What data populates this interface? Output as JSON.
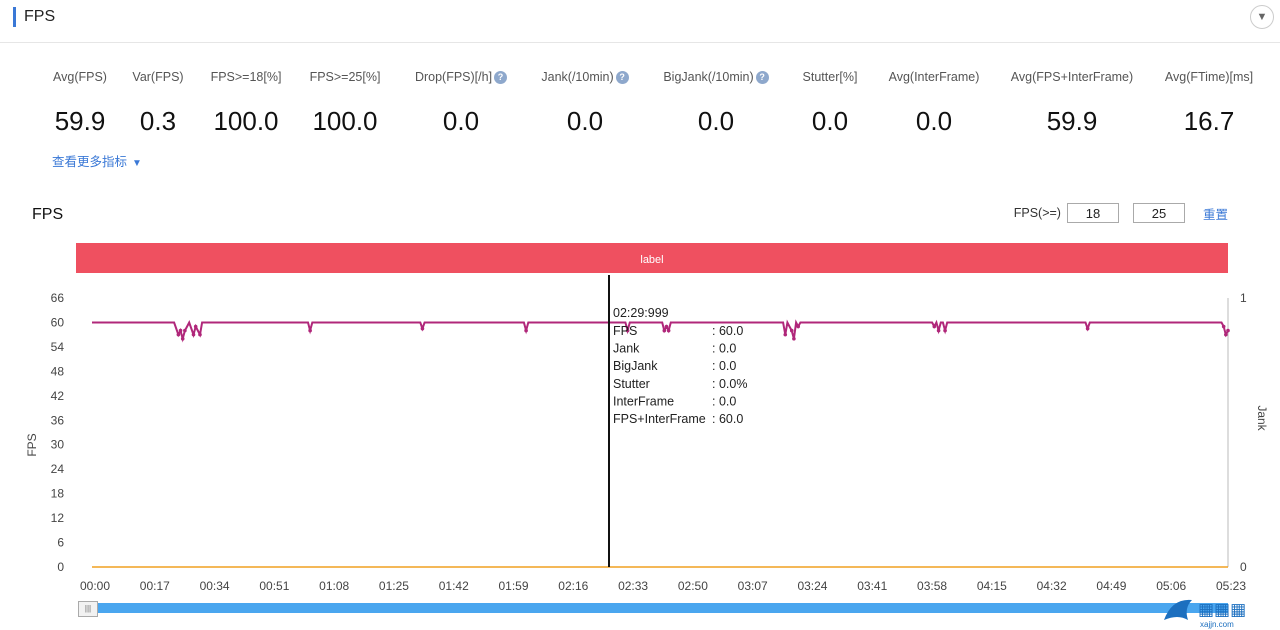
{
  "panel": {
    "title": "FPS"
  },
  "metrics": [
    {
      "label": "Avg(FPS)",
      "value": "59.9",
      "help": false
    },
    {
      "label": "Var(FPS)",
      "value": "0.3",
      "help": false
    },
    {
      "label": "FPS>=18[%]",
      "value": "100.0",
      "help": false
    },
    {
      "label": "FPS>=25[%]",
      "value": "100.0",
      "help": false
    },
    {
      "label": "Drop(FPS)[/h]",
      "value": "0.0",
      "help": true
    },
    {
      "label": "Jank(/10min)",
      "value": "0.0",
      "help": true
    },
    {
      "label": "BigJank(/10min)",
      "value": "0.0",
      "help": true
    },
    {
      "label": "Stutter[%]",
      "value": "0.0",
      "help": false
    },
    {
      "label": "Avg(InterFrame)",
      "value": "0.0",
      "help": false
    },
    {
      "label": "Avg(FPS+InterFrame)",
      "value": "59.9",
      "help": false
    },
    {
      "label": "Avg(FTime)[ms]",
      "value": "16.7",
      "help": false
    }
  ],
  "more_link": "查看更多指标",
  "chart_header": {
    "title": "FPS",
    "threshold_label": "FPS(>=)",
    "threshold_1": "18",
    "threshold_2": "25",
    "reset_label": "重置"
  },
  "label_bar": {
    "text": "label",
    "color": "#ef5060"
  },
  "tooltip": {
    "time": "02:29:999",
    "rows": [
      {
        "k": "FPS",
        "v": ": 60.0"
      },
      {
        "k": "Jank",
        "v": ": 0.0"
      },
      {
        "k": "BigJank",
        "v": ": 0.0"
      },
      {
        "k": "Stutter",
        "v": ": 0.0%"
      },
      {
        "k": "InterFrame",
        "v": ": 0.0"
      },
      {
        "k": "FPS+InterFrame",
        "v": ": 60.0"
      }
    ]
  },
  "watermark": {
    "text": "xajjn.com"
  },
  "chart_data": {
    "type": "line",
    "ylabel": "FPS",
    "y2label": "Jank",
    "ylim": [
      0,
      66
    ],
    "yticks": [
      0,
      6,
      12,
      18,
      24,
      30,
      36,
      42,
      48,
      54,
      60,
      66
    ],
    "y2lim": [
      0,
      1
    ],
    "y2ticks": [
      0,
      1
    ],
    "xticks": [
      "00:00",
      "00:17",
      "00:34",
      "00:51",
      "01:08",
      "01:25",
      "01:42",
      "01:59",
      "02:16",
      "02:33",
      "02:50",
      "03:07",
      "03:24",
      "03:41",
      "03:58",
      "04:15",
      "04:32",
      "04:49",
      "05:06",
      "05:23"
    ],
    "cursor_x": "02:29",
    "series": [
      {
        "name": "FPS",
        "color": "#b0277a",
        "x": [
          0,
          38,
          40,
          41,
          42,
          43,
          45,
          47,
          48,
          50,
          51,
          52,
          54,
          100,
          101,
          102,
          152,
          153,
          154,
          200,
          201,
          202,
          247,
          248,
          249,
          264,
          265,
          266,
          267,
          268,
          320,
          321,
          322,
          324,
          325,
          326,
          327,
          328,
          389,
          390,
          391,
          392,
          393,
          394,
          395,
          396,
          397,
          460,
          461,
          462,
          523,
          524,
          525,
          526
        ],
        "values": [
          60,
          60,
          57,
          58,
          56,
          58,
          60,
          57,
          59,
          57,
          60,
          60,
          60,
          60,
          58,
          60,
          60,
          58.5,
          60,
          60,
          58,
          60,
          60,
          58,
          60,
          60,
          58,
          59,
          58,
          60,
          60,
          57,
          60,
          58,
          56,
          60,
          59,
          60,
          60,
          59,
          60,
          58,
          60,
          60,
          58,
          60,
          60,
          60,
          58.5,
          60,
          60,
          59,
          57,
          58
        ]
      },
      {
        "name": "Jank",
        "color": "#f0a020",
        "x": [
          0,
          526
        ],
        "values": [
          0,
          0
        ]
      }
    ]
  }
}
